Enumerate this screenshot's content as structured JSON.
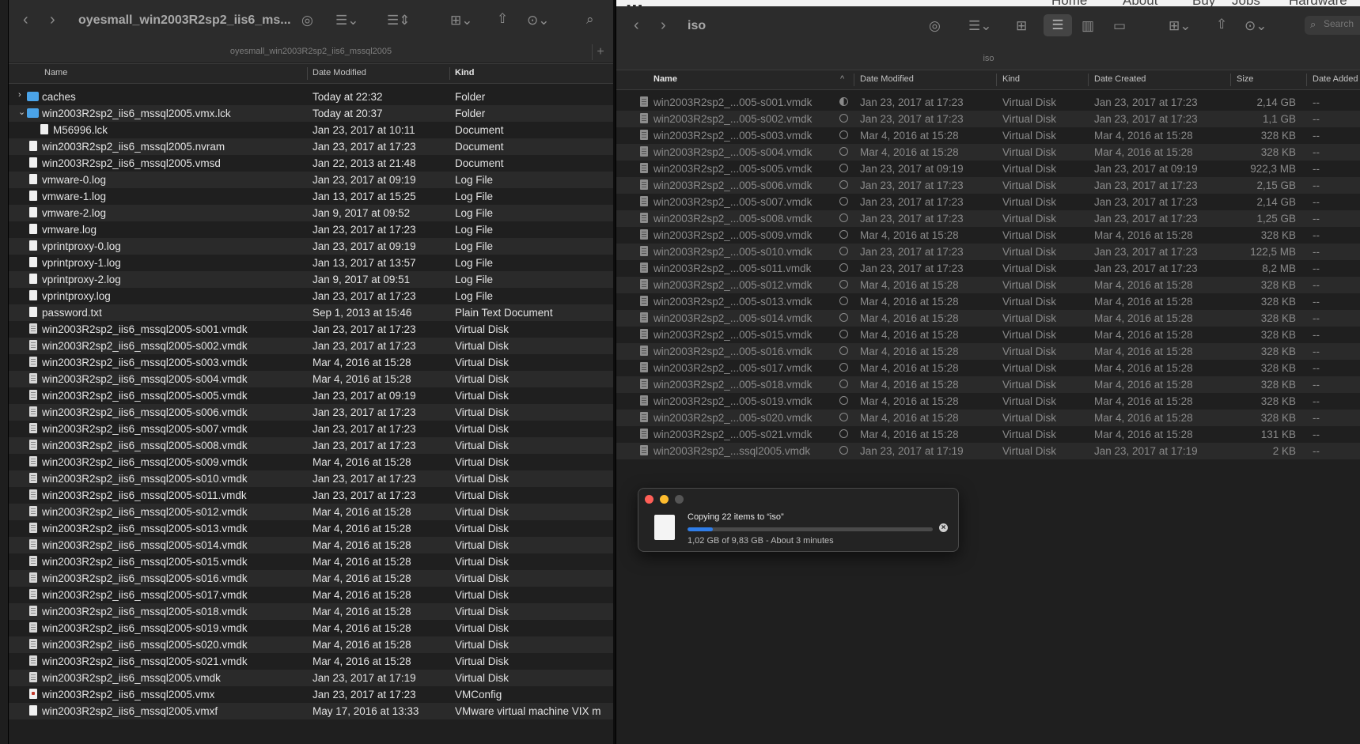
{
  "left": {
    "title": "oyesmall_win2003R2sp2_iis6_ms...",
    "subtitle": "oyesmall_win2003R2sp2_iis6_mssql2005",
    "add_tab_label": "+",
    "columns": {
      "name": "Name",
      "date": "Date Modified",
      "kind": "Kind"
    },
    "rows": [
      {
        "name": "caches",
        "date": "Today at 22:32",
        "kind": "Folder",
        "icon": "folder-icon",
        "disclosure": "›"
      },
      {
        "name": "win2003R2sp2_iis6_mssql2005.vmx.lck",
        "date": "Today at 20:37",
        "kind": "Folder",
        "icon": "folder-icon",
        "disclosure": "⌄"
      },
      {
        "name": "M56996.lck",
        "date": "Jan 23, 2017 at 10:11",
        "kind": "Document",
        "icon": "document-icon",
        "indent": true
      },
      {
        "name": "win2003R2sp2_iis6_mssql2005.nvram",
        "date": "Jan 23, 2017 at 17:23",
        "kind": "Document",
        "icon": "document-icon"
      },
      {
        "name": "win2003R2sp2_iis6_mssql2005.vmsd",
        "date": "Jan 22, 2013 at 21:48",
        "kind": "Document",
        "icon": "document-icon"
      },
      {
        "name": "vmware-0.log",
        "date": "Jan 23, 2017 at 09:19",
        "kind": "Log File",
        "icon": "document-icon"
      },
      {
        "name": "vmware-1.log",
        "date": "Jan 13, 2017 at 15:25",
        "kind": "Log File",
        "icon": "document-icon"
      },
      {
        "name": "vmware-2.log",
        "date": "Jan 9, 2017 at 09:52",
        "kind": "Log File",
        "icon": "document-icon"
      },
      {
        "name": "vmware.log",
        "date": "Jan 23, 2017 at 17:23",
        "kind": "Log File",
        "icon": "document-icon"
      },
      {
        "name": "vprintproxy-0.log",
        "date": "Jan 23, 2017 at 09:19",
        "kind": "Log File",
        "icon": "document-icon"
      },
      {
        "name": "vprintproxy-1.log",
        "date": "Jan 13, 2017 at 13:57",
        "kind": "Log File",
        "icon": "document-icon"
      },
      {
        "name": "vprintproxy-2.log",
        "date": "Jan 9, 2017 at 09:51",
        "kind": "Log File",
        "icon": "document-icon"
      },
      {
        "name": "vprintproxy.log",
        "date": "Jan 23, 2017 at 17:23",
        "kind": "Log File",
        "icon": "document-icon"
      },
      {
        "name": "password.txt",
        "date": "Sep 1, 2013 at 15:46",
        "kind": "Plain Text Document",
        "icon": "document-icon"
      },
      {
        "name": "win2003R2sp2_iis6_mssql2005-s001.vmdk",
        "date": "Jan 23, 2017 at 17:23",
        "kind": "Virtual Disk",
        "icon": "virtual-disk-icon"
      },
      {
        "name": "win2003R2sp2_iis6_mssql2005-s002.vmdk",
        "date": "Jan 23, 2017 at 17:23",
        "kind": "Virtual Disk",
        "icon": "virtual-disk-icon"
      },
      {
        "name": "win2003R2sp2_iis6_mssql2005-s003.vmdk",
        "date": "Mar 4, 2016 at 15:28",
        "kind": "Virtual Disk",
        "icon": "virtual-disk-icon"
      },
      {
        "name": "win2003R2sp2_iis6_mssql2005-s004.vmdk",
        "date": "Mar 4, 2016 at 15:28",
        "kind": "Virtual Disk",
        "icon": "virtual-disk-icon"
      },
      {
        "name": "win2003R2sp2_iis6_mssql2005-s005.vmdk",
        "date": "Jan 23, 2017 at 09:19",
        "kind": "Virtual Disk",
        "icon": "virtual-disk-icon"
      },
      {
        "name": "win2003R2sp2_iis6_mssql2005-s006.vmdk",
        "date": "Jan 23, 2017 at 17:23",
        "kind": "Virtual Disk",
        "icon": "virtual-disk-icon"
      },
      {
        "name": "win2003R2sp2_iis6_mssql2005-s007.vmdk",
        "date": "Jan 23, 2017 at 17:23",
        "kind": "Virtual Disk",
        "icon": "virtual-disk-icon"
      },
      {
        "name": "win2003R2sp2_iis6_mssql2005-s008.vmdk",
        "date": "Jan 23, 2017 at 17:23",
        "kind": "Virtual Disk",
        "icon": "virtual-disk-icon"
      },
      {
        "name": "win2003R2sp2_iis6_mssql2005-s009.vmdk",
        "date": "Mar 4, 2016 at 15:28",
        "kind": "Virtual Disk",
        "icon": "virtual-disk-icon"
      },
      {
        "name": "win2003R2sp2_iis6_mssql2005-s010.vmdk",
        "date": "Jan 23, 2017 at 17:23",
        "kind": "Virtual Disk",
        "icon": "virtual-disk-icon"
      },
      {
        "name": "win2003R2sp2_iis6_mssql2005-s011.vmdk",
        "date": "Jan 23, 2017 at 17:23",
        "kind": "Virtual Disk",
        "icon": "virtual-disk-icon"
      },
      {
        "name": "win2003R2sp2_iis6_mssql2005-s012.vmdk",
        "date": "Mar 4, 2016 at 15:28",
        "kind": "Virtual Disk",
        "icon": "virtual-disk-icon"
      },
      {
        "name": "win2003R2sp2_iis6_mssql2005-s013.vmdk",
        "date": "Mar 4, 2016 at 15:28",
        "kind": "Virtual Disk",
        "icon": "virtual-disk-icon"
      },
      {
        "name": "win2003R2sp2_iis6_mssql2005-s014.vmdk",
        "date": "Mar 4, 2016 at 15:28",
        "kind": "Virtual Disk",
        "icon": "virtual-disk-icon"
      },
      {
        "name": "win2003R2sp2_iis6_mssql2005-s015.vmdk",
        "date": "Mar 4, 2016 at 15:28",
        "kind": "Virtual Disk",
        "icon": "virtual-disk-icon"
      },
      {
        "name": "win2003R2sp2_iis6_mssql2005-s016.vmdk",
        "date": "Mar 4, 2016 at 15:28",
        "kind": "Virtual Disk",
        "icon": "virtual-disk-icon"
      },
      {
        "name": "win2003R2sp2_iis6_mssql2005-s017.vmdk",
        "date": "Mar 4, 2016 at 15:28",
        "kind": "Virtual Disk",
        "icon": "virtual-disk-icon"
      },
      {
        "name": "win2003R2sp2_iis6_mssql2005-s018.vmdk",
        "date": "Mar 4, 2016 at 15:28",
        "kind": "Virtual Disk",
        "icon": "virtual-disk-icon"
      },
      {
        "name": "win2003R2sp2_iis6_mssql2005-s019.vmdk",
        "date": "Mar 4, 2016 at 15:28",
        "kind": "Virtual Disk",
        "icon": "virtual-disk-icon"
      },
      {
        "name": "win2003R2sp2_iis6_mssql2005-s020.vmdk",
        "date": "Mar 4, 2016 at 15:28",
        "kind": "Virtual Disk",
        "icon": "virtual-disk-icon"
      },
      {
        "name": "win2003R2sp2_iis6_mssql2005-s021.vmdk",
        "date": "Mar 4, 2016 at 15:28",
        "kind": "Virtual Disk",
        "icon": "virtual-disk-icon"
      },
      {
        "name": "win2003R2sp2_iis6_mssql2005.vmdk",
        "date": "Jan 23, 2017 at 17:19",
        "kind": "Virtual Disk",
        "icon": "virtual-disk-icon"
      },
      {
        "name": "win2003R2sp2_iis6_mssql2005.vmx",
        "date": "Jan 23, 2017 at 17:23",
        "kind": "VMConfig",
        "icon": "vmconfig-icon"
      },
      {
        "name": "win2003R2sp2_iis6_mssql2005.vmxf",
        "date": "May 17, 2016 at 13:33",
        "kind": "VMware virtual machine VIX m",
        "icon": "document-icon"
      }
    ]
  },
  "right": {
    "title": "iso",
    "subtitle": "iso",
    "search_placeholder": "Search",
    "sort_indicator": "^",
    "columns": {
      "name": "Name",
      "date_modified": "Date Modified",
      "kind": "Kind",
      "date_created": "Date Created",
      "size": "Size",
      "date_added": "Date Added"
    },
    "rows": [
      {
        "name": "win2003R2sp2_...005-s001.vmdk",
        "date_modified": "Jan 23, 2017 at 17:23",
        "kind": "Virtual Disk",
        "date_created": "Jan 23, 2017 at 17:23",
        "size": "2,14 GB",
        "date_added": "--",
        "status": "half"
      },
      {
        "name": "win2003R2sp2_...005-s002.vmdk",
        "date_modified": "Jan 23, 2017 at 17:23",
        "kind": "Virtual Disk",
        "date_created": "Jan 23, 2017 at 17:23",
        "size": "1,1 GB",
        "date_added": "--",
        "status": "pending"
      },
      {
        "name": "win2003R2sp2_...005-s003.vmdk",
        "date_modified": "Mar 4, 2016 at 15:28",
        "kind": "Virtual Disk",
        "date_created": "Mar 4, 2016 at 15:28",
        "size": "328 KB",
        "date_added": "--",
        "status": "pending"
      },
      {
        "name": "win2003R2sp2_...005-s004.vmdk",
        "date_modified": "Mar 4, 2016 at 15:28",
        "kind": "Virtual Disk",
        "date_created": "Mar 4, 2016 at 15:28",
        "size": "328 KB",
        "date_added": "--",
        "status": "pending"
      },
      {
        "name": "win2003R2sp2_...005-s005.vmdk",
        "date_modified": "Jan 23, 2017 at 09:19",
        "kind": "Virtual Disk",
        "date_created": "Jan 23, 2017 at 09:19",
        "size": "922,3 MB",
        "date_added": "--",
        "status": "pending"
      },
      {
        "name": "win2003R2sp2_...005-s006.vmdk",
        "date_modified": "Jan 23, 2017 at 17:23",
        "kind": "Virtual Disk",
        "date_created": "Jan 23, 2017 at 17:23",
        "size": "2,15 GB",
        "date_added": "--",
        "status": "pending"
      },
      {
        "name": "win2003R2sp2_...005-s007.vmdk",
        "date_modified": "Jan 23, 2017 at 17:23",
        "kind": "Virtual Disk",
        "date_created": "Jan 23, 2017 at 17:23",
        "size": "2,14 GB",
        "date_added": "--",
        "status": "pending"
      },
      {
        "name": "win2003R2sp2_...005-s008.vmdk",
        "date_modified": "Jan 23, 2017 at 17:23",
        "kind": "Virtual Disk",
        "date_created": "Jan 23, 2017 at 17:23",
        "size": "1,25 GB",
        "date_added": "--",
        "status": "pending"
      },
      {
        "name": "win2003R2sp2_...005-s009.vmdk",
        "date_modified": "Mar 4, 2016 at 15:28",
        "kind": "Virtual Disk",
        "date_created": "Mar 4, 2016 at 15:28",
        "size": "328 KB",
        "date_added": "--",
        "status": "pending"
      },
      {
        "name": "win2003R2sp2_...005-s010.vmdk",
        "date_modified": "Jan 23, 2017 at 17:23",
        "kind": "Virtual Disk",
        "date_created": "Jan 23, 2017 at 17:23",
        "size": "122,5 MB",
        "date_added": "--",
        "status": "pending"
      },
      {
        "name": "win2003R2sp2_...005-s011.vmdk",
        "date_modified": "Jan 23, 2017 at 17:23",
        "kind": "Virtual Disk",
        "date_created": "Jan 23, 2017 at 17:23",
        "size": "8,2 MB",
        "date_added": "--",
        "status": "pending"
      },
      {
        "name": "win2003R2sp2_...005-s012.vmdk",
        "date_modified": "Mar 4, 2016 at 15:28",
        "kind": "Virtual Disk",
        "date_created": "Mar 4, 2016 at 15:28",
        "size": "328 KB",
        "date_added": "--",
        "status": "pending"
      },
      {
        "name": "win2003R2sp2_...005-s013.vmdk",
        "date_modified": "Mar 4, 2016 at 15:28",
        "kind": "Virtual Disk",
        "date_created": "Mar 4, 2016 at 15:28",
        "size": "328 KB",
        "date_added": "--",
        "status": "pending"
      },
      {
        "name": "win2003R2sp2_...005-s014.vmdk",
        "date_modified": "Mar 4, 2016 at 15:28",
        "kind": "Virtual Disk",
        "date_created": "Mar 4, 2016 at 15:28",
        "size": "328 KB",
        "date_added": "--",
        "status": "pending"
      },
      {
        "name": "win2003R2sp2_...005-s015.vmdk",
        "date_modified": "Mar 4, 2016 at 15:28",
        "kind": "Virtual Disk",
        "date_created": "Mar 4, 2016 at 15:28",
        "size": "328 KB",
        "date_added": "--",
        "status": "pending"
      },
      {
        "name": "win2003R2sp2_...005-s016.vmdk",
        "date_modified": "Mar 4, 2016 at 15:28",
        "kind": "Virtual Disk",
        "date_created": "Mar 4, 2016 at 15:28",
        "size": "328 KB",
        "date_added": "--",
        "status": "pending"
      },
      {
        "name": "win2003R2sp2_...005-s017.vmdk",
        "date_modified": "Mar 4, 2016 at 15:28",
        "kind": "Virtual Disk",
        "date_created": "Mar 4, 2016 at 15:28",
        "size": "328 KB",
        "date_added": "--",
        "status": "pending"
      },
      {
        "name": "win2003R2sp2_...005-s018.vmdk",
        "date_modified": "Mar 4, 2016 at 15:28",
        "kind": "Virtual Disk",
        "date_created": "Mar 4, 2016 at 15:28",
        "size": "328 KB",
        "date_added": "--",
        "status": "pending"
      },
      {
        "name": "win2003R2sp2_...005-s019.vmdk",
        "date_modified": "Mar 4, 2016 at 15:28",
        "kind": "Virtual Disk",
        "date_created": "Mar 4, 2016 at 15:28",
        "size": "328 KB",
        "date_added": "--",
        "status": "pending"
      },
      {
        "name": "win2003R2sp2_...005-s020.vmdk",
        "date_modified": "Mar 4, 2016 at 15:28",
        "kind": "Virtual Disk",
        "date_created": "Mar 4, 2016 at 15:28",
        "size": "328 KB",
        "date_added": "--",
        "status": "pending"
      },
      {
        "name": "win2003R2sp2_...005-s021.vmdk",
        "date_modified": "Mar 4, 2016 at 15:28",
        "kind": "Virtual Disk",
        "date_created": "Mar 4, 2016 at 15:28",
        "size": "131 KB",
        "date_added": "--",
        "status": "pending"
      },
      {
        "name": "win2003R2sp2_...ssql2005.vmdk",
        "date_modified": "Jan 23, 2017 at 17:19",
        "kind": "Virtual Disk",
        "date_created": "Jan 23, 2017 at 17:19",
        "size": "2 KB",
        "date_added": "--",
        "status": "pending"
      }
    ]
  },
  "backdrop": {
    "brand": "...",
    "nav": [
      "Home",
      "About",
      "Buy",
      "Jobs",
      "Hardware"
    ]
  },
  "copy_dialog": {
    "title": "Copying 22 items to “iso”",
    "status": "1,02 GB of 9,83 GB - About 3 minutes",
    "progress_fraction": 0.104
  },
  "colors": {
    "accent": "#2f7de8",
    "close": "#ff5f57",
    "minimize": "#febc2e",
    "zoom_inactive": "#555555",
    "folder": "#4aa3e8"
  }
}
